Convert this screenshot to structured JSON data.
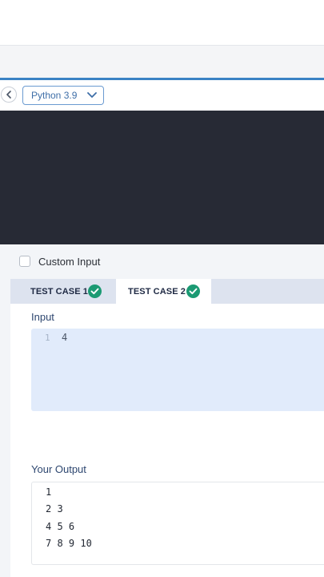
{
  "toolbar": {
    "language": "Python 3.9"
  },
  "custom_input": {
    "label": "Custom Input",
    "checked": false
  },
  "tabs": [
    {
      "label": "TEST CASE 1",
      "passed": true,
      "active": false
    },
    {
      "label": "TEST CASE 2",
      "passed": true,
      "active": true
    }
  ],
  "input": {
    "label": "Input",
    "line_number": "1",
    "value": "4"
  },
  "output": {
    "label": "Your Output",
    "lines": [
      "1",
      "2 3",
      "4 5 6",
      "7 8 9 10"
    ]
  },
  "colors": {
    "accent": "#3b82c4",
    "editor_bg": "#272a35",
    "success": "#1b9a73"
  }
}
